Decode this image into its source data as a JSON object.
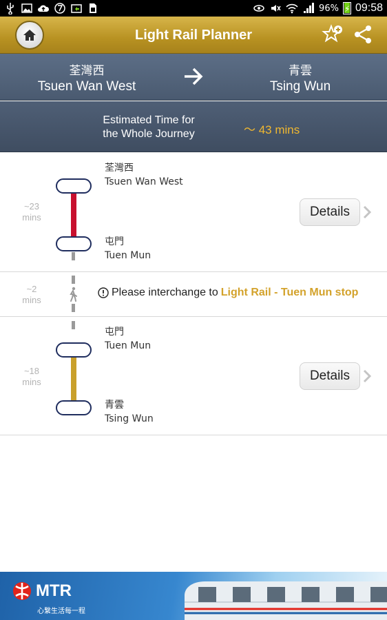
{
  "status_bar": {
    "battery": "96%",
    "battery_level": 0.96,
    "time": "09:58",
    "left_icons": [
      "usb-icon",
      "image-icon",
      "cloud-upload-icon",
      "sync-icon",
      "screenshot-icon",
      "sim-card-icon"
    ],
    "right_icons": [
      "eye-icon",
      "mute-icon",
      "wifi-icon",
      "signal-icon",
      "battery-icon"
    ]
  },
  "header": {
    "title": "Light Rail Planner"
  },
  "route": {
    "from_zh": "荃灣西",
    "from_en": "Tsuen Wan West",
    "to_zh": "青雲",
    "to_en": "Tsing Wun"
  },
  "estimate": {
    "label_line1": "Estimated Time for",
    "label_line2": "the Whole Journey",
    "value": "～ 43 mins"
  },
  "legs": [
    {
      "mins_approx": "~23",
      "mins_unit": "mins",
      "start_zh": "荃灣西",
      "start_en": "Tsuen Wan West",
      "end_zh": "屯門",
      "end_en": "Tuen Mun",
      "color": "#c8102e",
      "details_label": "Details"
    },
    {
      "mins_approx": "~18",
      "mins_unit": "mins",
      "start_zh": "屯門",
      "start_en": "Tuen Mun",
      "end_zh": "青雲",
      "end_en": "Tsing Wun",
      "color": "#c9a02b",
      "details_label": "Details"
    }
  ],
  "interchange": {
    "mins_approx": "~2",
    "mins_unit": "mins",
    "text": "Please interchange to",
    "highlight": "Light Rail - Tuen Mun stop"
  },
  "banner": {
    "brand": "MTR",
    "tagline": "心繫生活每一程"
  },
  "colors": {
    "header_gold": "#b89222",
    "route_bg": "#4f5f76",
    "highlight_gold": "#d3a22b",
    "estimate_gold": "#f0b830"
  }
}
